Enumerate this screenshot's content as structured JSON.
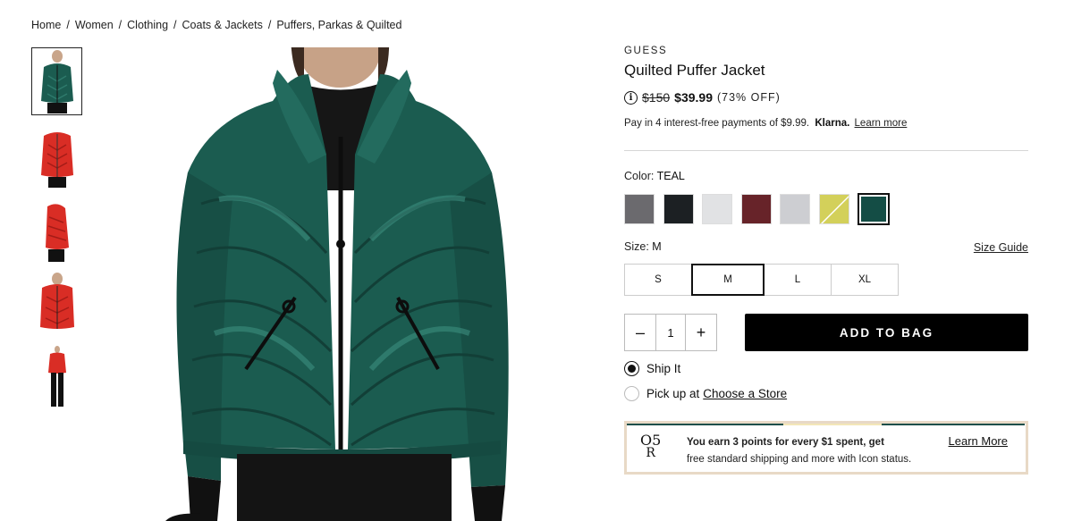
{
  "breadcrumb": [
    "Home",
    "Women",
    "Clothing",
    "Coats & Jackets",
    "Puffers, Parkas & Quilted"
  ],
  "breadcrumb_sep": "/",
  "product": {
    "brand": "GUESS",
    "title": "Quilted Puffer Jacket",
    "info_icon": "i",
    "old_price": "$150",
    "sale_price": "$39.99",
    "discount": "(73% OFF)"
  },
  "klarna": {
    "text": "Pay in 4 interest-free payments of $9.99.",
    "logo": "Klarna.",
    "link": "Learn more"
  },
  "color": {
    "label": "Color:",
    "selected": "TEAL",
    "swatches": [
      {
        "name": "gray",
        "hex": "#6b6a6e"
      },
      {
        "name": "black",
        "hex": "#1c2023"
      },
      {
        "name": "light-gray",
        "hex": "#e1e2e4"
      },
      {
        "name": "burgundy",
        "hex": "#672329"
      },
      {
        "name": "silver",
        "hex": "#cdced2"
      },
      {
        "name": "lime",
        "hex": "#d3d05a"
      },
      {
        "name": "teal",
        "hex": "#144d45"
      }
    ]
  },
  "size": {
    "label": "Size:",
    "selected": "M",
    "guide": "Size Guide",
    "options": [
      "S",
      "M",
      "L",
      "XL"
    ]
  },
  "quantity": {
    "minus": "–",
    "value": "1",
    "plus": "+"
  },
  "add_to_bag": "ADD TO BAG",
  "fulfillment": {
    "ship": "Ship It",
    "pickup_prefix": "Pick up at",
    "pickup_link": "Choose a Store"
  },
  "loyalty": {
    "logo_top": "O5",
    "logo_bottom": "R",
    "line1": "You earn 3 points for every $1 spent, get",
    "line2": "free standard shipping and more with Icon status.",
    "link": "Learn More"
  },
  "colors": {
    "jacket_teal": "#1b5c50",
    "jacket_red": "#d92d25"
  }
}
